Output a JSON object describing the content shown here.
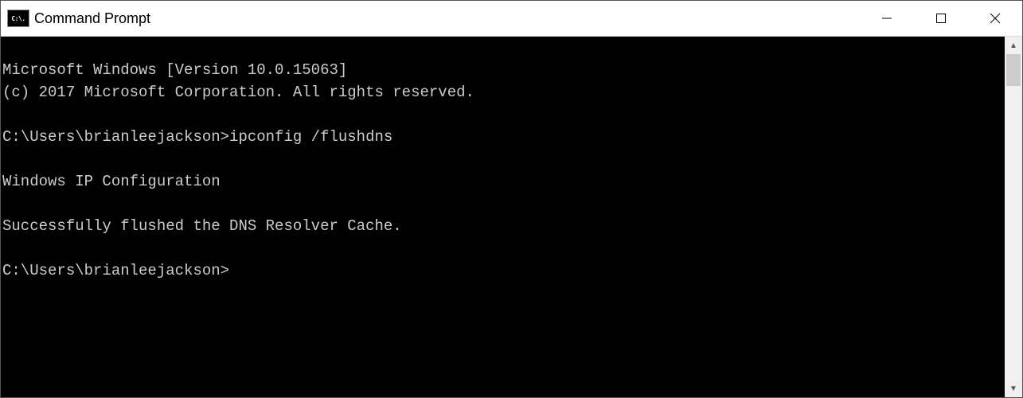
{
  "window": {
    "title": "Command Prompt",
    "icon_label": "C:\\."
  },
  "terminal": {
    "lines": [
      "Microsoft Windows [Version 10.0.15063]",
      "(c) 2017 Microsoft Corporation. All rights reserved.",
      "",
      "C:\\Users\\brianleejackson>ipconfig /flushdns",
      "",
      "Windows IP Configuration",
      "",
      "Successfully flushed the DNS Resolver Cache.",
      "",
      "C:\\Users\\brianleejackson>"
    ],
    "prompt_path": "C:\\Users\\brianleejackson",
    "command_entered": "ipconfig /flushdns",
    "output_header": "Windows IP Configuration",
    "output_message": "Successfully flushed the DNS Resolver Cache.",
    "os_version_line": "Microsoft Windows [Version 10.0.15063]",
    "copyright_line": "(c) 2017 Microsoft Corporation. All rights reserved."
  }
}
